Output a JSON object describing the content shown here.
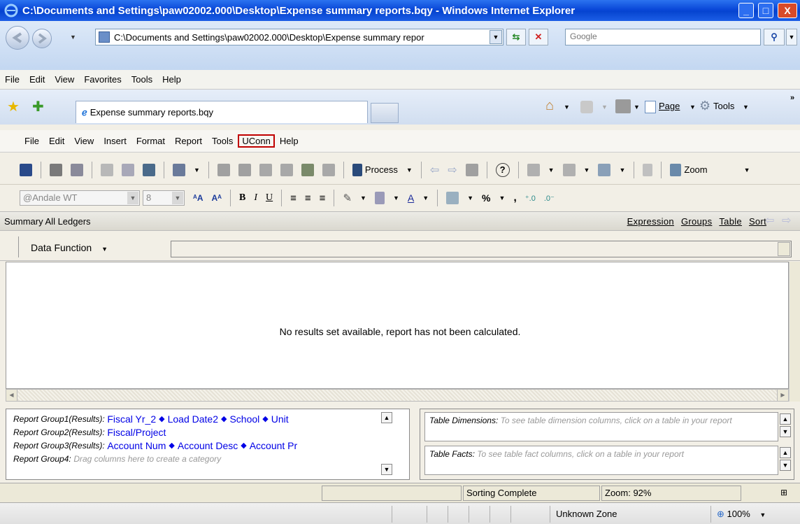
{
  "window": {
    "title": "C:\\Documents and Settings\\paw02002.000\\Desktop\\Expense summary reports.bqy - Windows Internet Explorer",
    "minimize": "_",
    "maximize": "□",
    "close": "X"
  },
  "address": {
    "url": "C:\\Documents and Settings\\paw02002.000\\Desktop\\Expense summary repor",
    "search_placeholder": "Google"
  },
  "ie_menu": [
    "File",
    "Edit",
    "View",
    "Favorites",
    "Tools",
    "Help"
  ],
  "tab": {
    "label": "Expense summary reports.bqy"
  },
  "favbar_right": {
    "page": "Page",
    "tools": "Tools"
  },
  "app_menu": [
    "File",
    "Edit",
    "View",
    "Insert",
    "Format",
    "Report",
    "Tools",
    "UConn",
    "Help"
  ],
  "toolbar": {
    "process": "Process",
    "zoom": "Zoom"
  },
  "format": {
    "font": "@Andale WT",
    "size": "8",
    "bold": "B",
    "italic": "I",
    "underline": "U",
    "percent": "%",
    "comma": ","
  },
  "section": {
    "title": "Summary All Ledgers",
    "links": [
      "Expression",
      "Groups",
      "Table",
      "Sort"
    ]
  },
  "data_function": {
    "label": "Data Function"
  },
  "results": {
    "message": "No results set available, report has not been calculated."
  },
  "groups": [
    {
      "label": "Report Group1(Results):",
      "values": [
        "Fiscal Yr_2",
        "Load Date2",
        "School",
        "Unit"
      ]
    },
    {
      "label": "Report Group2(Results):",
      "values": [
        "Fiscal/Project"
      ]
    },
    {
      "label": "Report Group3(Results):",
      "values": [
        "Account Num",
        "Account Desc",
        "Account Pr"
      ]
    },
    {
      "label": "Report Group4:",
      "hint": "Drag columns here to create a category"
    }
  ],
  "table_pane": {
    "dimensions_label": "Table Dimensions:",
    "dimensions_hint": "To see table dimension columns, click on a table in your report",
    "facts_label": "Table Facts:",
    "facts_hint": "To see table fact columns, click on a table in your report"
  },
  "app_status": {
    "sorting": "Sorting Complete",
    "zoom": "Zoom: 92%"
  },
  "ie_status": {
    "zone": "Unknown Zone",
    "zoom": "100%"
  }
}
